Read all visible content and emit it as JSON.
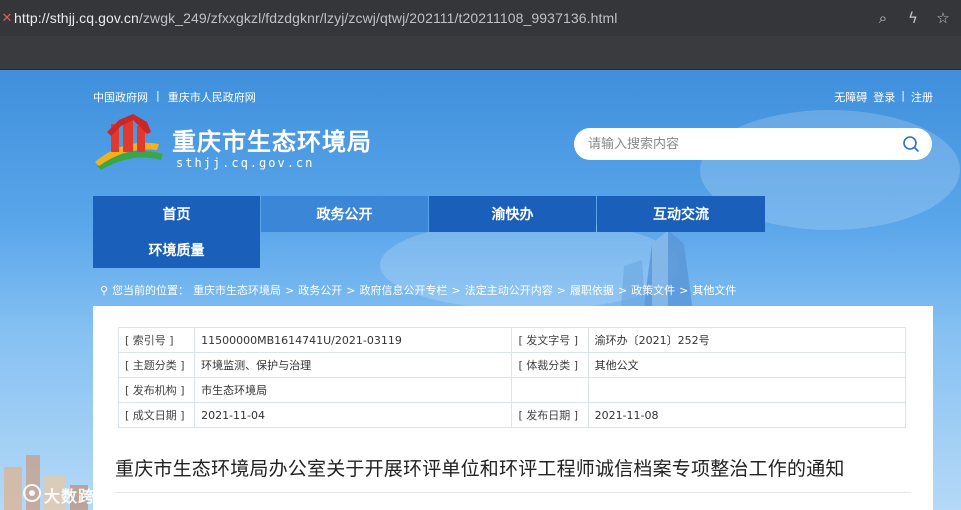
{
  "browser": {
    "url_host": "http://sthjj.cq.gov.cn",
    "url_path": "/zwgk_249/zfxxgkzl/fdzdgknr/lzyj/zcwj/qtwj/202111/t20211108_9937136.html"
  },
  "header": {
    "links_left": [
      "中国政府网",
      "|",
      "重庆市人民政府网"
    ],
    "links_right": [
      "无障碍",
      "登录",
      "|",
      "注册"
    ],
    "site_title": "重庆市生态环境局",
    "site_domain": "sthjj.cq.gov.cn",
    "search_placeholder": "请输入搜索内容"
  },
  "nav": {
    "items": [
      "首页",
      "政务公开",
      "渝快办",
      "互动交流",
      "环境质量"
    ],
    "active": "政务公开"
  },
  "breadcrumb": {
    "prefix": "您当前的位置：",
    "items": [
      "重庆市生态环境局",
      "政务公开",
      "政府信息公开专栏",
      "法定主动公开内容",
      "履职依据",
      "政策文件",
      "其他文件"
    ],
    "separator": ">"
  },
  "meta": {
    "rows": [
      {
        "l1": "[ 索引号 ]",
        "v1": "11500000MB1614741U/2021-03119",
        "l2": "[ 发文字号 ]",
        "v2": "渝环办〔2021〕252号"
      },
      {
        "l1": "[ 主题分类 ]",
        "v1": "环境监测、保护与治理",
        "l2": "[ 体裁分类 ]",
        "v2": "其他公文"
      },
      {
        "l1": "[ 发布机构 ]",
        "v1": "市生态环境局",
        "l2": "",
        "v2": ""
      },
      {
        "l1": "[ 成文日期 ]",
        "v1": "2021-11-04",
        "l2": "[ 发布日期 ]",
        "v2": "2021-11-08"
      }
    ]
  },
  "document": {
    "title": "重庆市生态环境局办公室关于开展环评单位和环评工程师诚信档案专项整治工作的通知"
  },
  "watermark": {
    "text": "大数跨境"
  },
  "colors": {
    "nav_bg": "#1a5fb9",
    "nav_active": "#3c86d8",
    "chrome": "#35363a"
  }
}
